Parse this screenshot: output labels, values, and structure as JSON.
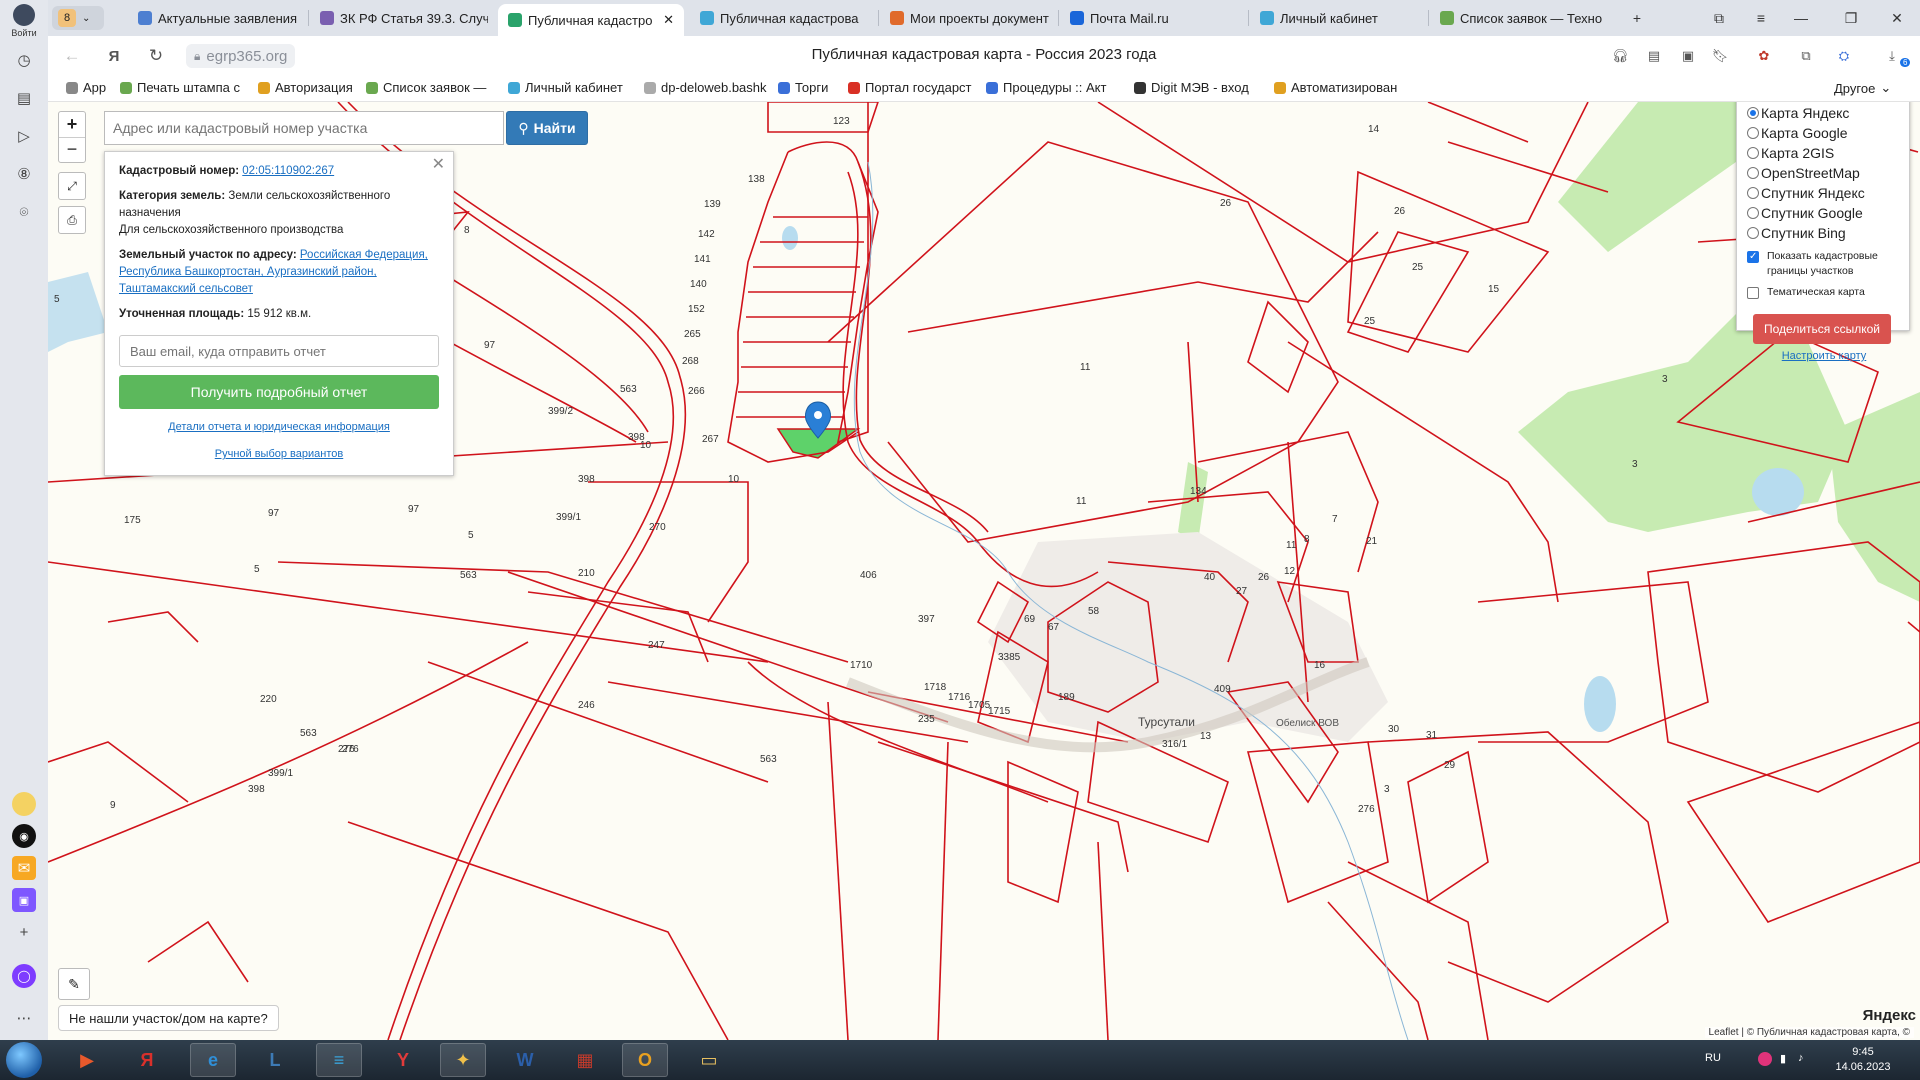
{
  "browser": {
    "tab_count": "8",
    "tabs": [
      {
        "label": "Актуальные заявления",
        "color": "#4d7fd1"
      },
      {
        "label": "ЗК РФ Статья 39.3. Случ",
        "color": "#7a5fb0"
      },
      {
        "label": "Публичная кадастро",
        "color": "#2aa36b",
        "active": true
      },
      {
        "label": "Публичная кадастрова",
        "color": "#3fa7d6"
      },
      {
        "label": "Мои проекты документ",
        "color": "#e06a2b"
      },
      {
        "label": "Почта Mail.ru",
        "color": "#1a66d9"
      },
      {
        "label": "Личный кабинет",
        "color": "#3fa7d6"
      },
      {
        "label": "Список заявок — Техно",
        "color": "#6aa84f"
      }
    ],
    "url": "egrp365.org",
    "page_title": "Публичная кадастровая карта - Россия 2023 года",
    "login_label": "Войти",
    "bookmarks": [
      {
        "label": "App",
        "color": "#888888"
      },
      {
        "label": "Печать штампа с",
        "color": "#6aa84f"
      },
      {
        "label": "Авторизация",
        "color": "#e0a020"
      },
      {
        "label": "Список заявок —",
        "color": "#6aa84f"
      },
      {
        "label": "Личный кабинет",
        "color": "#3fa7d6"
      },
      {
        "label": "dp-deloweb.bashk",
        "color": "#aaaaaa"
      },
      {
        "label": "Торги",
        "color": "#3a6fd8"
      },
      {
        "label": "Портал государст",
        "color": "#d93025"
      },
      {
        "label": "Процедуры :: Акт",
        "color": "#3a6fd8"
      },
      {
        "label": "Digit МЭВ - вход",
        "color": "#333333"
      },
      {
        "label": "Автоматизирован",
        "color": "#e0a020"
      }
    ],
    "bookmarks_other": "Другое",
    "download_badge": "6"
  },
  "map": {
    "search_placeholder": "Адрес или кадастровый номер участка",
    "search_button": "Найти",
    "zoom_in": "+",
    "zoom_out": "−",
    "info": {
      "cad_label": "Кадастровый номер:",
      "cad_value": "02:05:110902:267",
      "cat_label": "Категория земель:",
      "cat_value": "Земли сельскохозяйственного назначения",
      "use_value": "Для сельскохозяйственного производства",
      "addr_label": "Земельный участок по адресу:",
      "addr_value": "Российская Федерация, Республика Башкортостан, Аургазинский район, Таштамакский сельсовет",
      "area_label": "Уточненная площадь:",
      "area_value": "15 912 кв.м.",
      "email_placeholder": "Ваш email, куда отправить отчет",
      "report_button": "Получить подробный отчет",
      "details_link": "Детали отчета и юридическая информация",
      "manual_link": "Ручной выбор вариантов"
    },
    "layers": [
      {
        "label": "Карта Яндекс",
        "selected": true
      },
      {
        "label": "Карта Google",
        "selected": false
      },
      {
        "label": "Карта 2GIS",
        "selected": false
      },
      {
        "label": "OpenStreetMap",
        "selected": false
      },
      {
        "label": "Спутник Яндекс",
        "selected": false
      },
      {
        "label": "Спутник Google",
        "selected": false
      },
      {
        "label": "Спутник Bing",
        "selected": false
      }
    ],
    "show_borders_label": "Показать кадастровые границы участков",
    "show_borders_checked": true,
    "thematic_label": "Тематическая карта",
    "thematic_checked": false,
    "share_button": "Поделиться ссылкой",
    "settings_link": "Настроить карту",
    "not_found": "Не нашли участок/дом на карте?",
    "attribution": "Leaflet | © Публичная кадастровая карта, ©",
    "yandex_logo": "Яндекс",
    "village": "Турсутали",
    "village_poi": "Обелиск ВОВ",
    "parcels": [
      "123",
      "138",
      "139",
      "142",
      "141",
      "140",
      "152",
      "265",
      "268",
      "266",
      "267",
      "563",
      "399/2",
      "14",
      "26",
      "26",
      "25",
      "15",
      "25",
      "11",
      "3",
      "3",
      "134",
      "11",
      "5",
      "97",
      "97",
      "97",
      "5",
      "5",
      "8",
      "10",
      "10",
      "398",
      "398",
      "399/1",
      "270",
      "210",
      "563",
      "406",
      "397",
      "247",
      "246",
      "220",
      "563",
      "276",
      "399/1",
      "398",
      "563",
      "276",
      "13",
      "3385",
      "235",
      "1710",
      "1718",
      "1716",
      "1705",
      "1715",
      "189",
      "316/1",
      "409",
      "16",
      "69",
      "67",
      "58",
      "40",
      "27",
      "26",
      "12",
      "11",
      "8",
      "7",
      "21",
      "31",
      "29",
      "30",
      "3",
      "276",
      "9",
      "175"
    ],
    "parcel_color": "#d0131b",
    "selected_color": "#5ed26a"
  },
  "taskbar": {
    "lang": "RU",
    "time": "9:45",
    "date": "14.06.2023",
    "apps": [
      "▶",
      "Я",
      "e",
      "L",
      "≡",
      "Y",
      "✦",
      "W",
      "▦",
      "O",
      "▭"
    ]
  }
}
